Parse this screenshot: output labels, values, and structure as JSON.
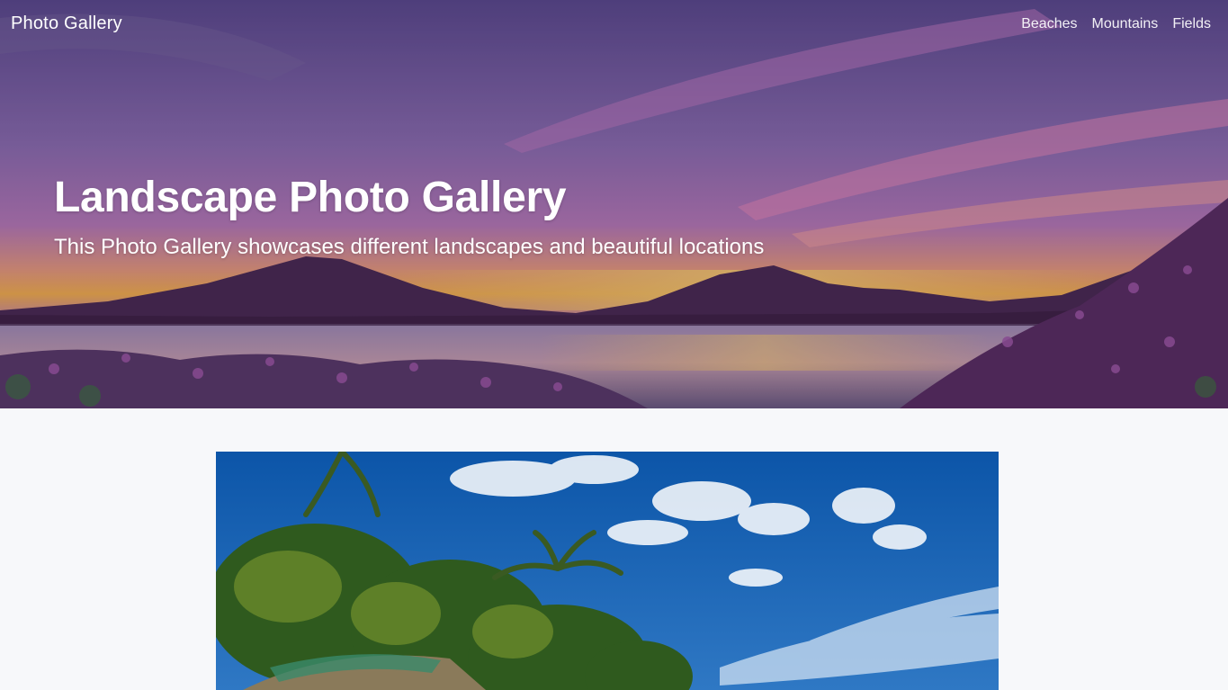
{
  "navbar": {
    "brand": "Photo Gallery",
    "links": [
      "Beaches",
      "Mountains",
      "Fields"
    ]
  },
  "hero": {
    "title": "Landscape Photo Gallery",
    "subtitle": "This Photo Gallery showcases different landscapes and beautiful locations"
  },
  "colors": {
    "page_background": "#f7f8fa",
    "hero_text": "#ffffff"
  }
}
